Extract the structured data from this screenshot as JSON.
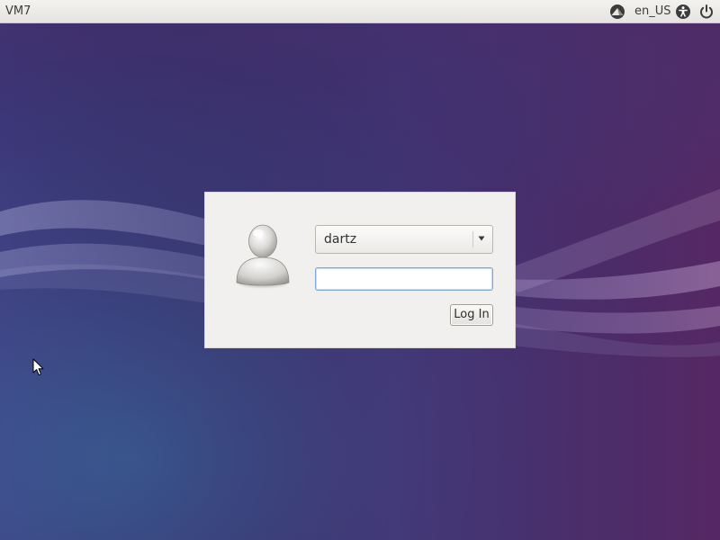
{
  "top_panel": {
    "hostname": "VM7",
    "locale": "en_US",
    "icons": [
      "network-icon",
      "accessibility-icon",
      "power-icon"
    ]
  },
  "login": {
    "avatar_icon": "user-avatar-icon",
    "username_selected": "dartz",
    "password_value": "",
    "password_placeholder": "",
    "login_button_label": "Log In"
  },
  "colors": {
    "wallpaper_primary": "#3b3f78",
    "wallpaper_accent": "#5b2a5e",
    "panel_background": "#e9e7e3",
    "dialog_background": "#f1f0ee",
    "focus_border": "#7ea9d8"
  }
}
